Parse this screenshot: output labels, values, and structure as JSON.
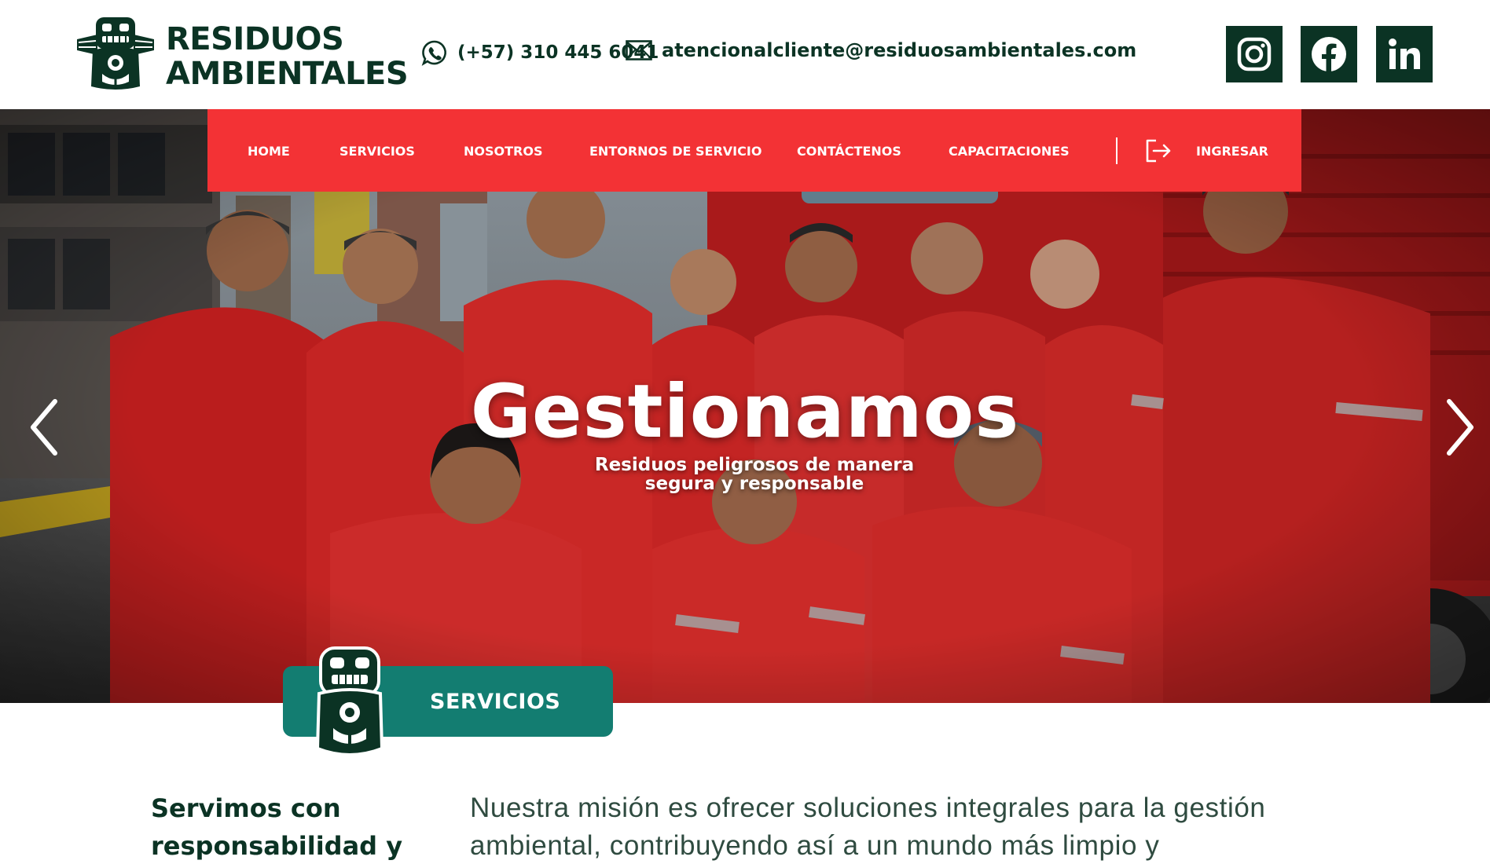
{
  "brand": {
    "line1": "RESIDUOS",
    "line2": "AMBIENTALES",
    "logo_icon": "mask-totem-logo",
    "color": "#0b3324"
  },
  "header": {
    "phone_icon": "whatsapp-icon",
    "phone": "(+57) 310 445 6041",
    "email_icon": "mail-icon",
    "email": "atencionalcliente@residuosambientales.com",
    "social": [
      {
        "icon": "instagram-icon"
      },
      {
        "icon": "facebook-icon"
      },
      {
        "icon": "linkedin-icon"
      }
    ]
  },
  "nav": {
    "color": "#f33235",
    "items": [
      "HOME",
      "SERVICIOS",
      "NOSOTROS",
      "ENTORNOS DE SERVICIO",
      "CONTÁCTENOS",
      "CAPACITACIONES"
    ],
    "login_icon": "login-icon",
    "login": "INGRESAR"
  },
  "hero": {
    "title": "Gestionamos",
    "subtitle": "Residuos peligrosos de manera segura y responsable",
    "prev_icon": "chevron-left-icon",
    "next_icon": "chevron-right-icon"
  },
  "services_badge": {
    "label": "SERVICIOS",
    "color": "#137d71"
  },
  "intro": {
    "heading": "Servimos con responsabilidad y",
    "text": "Nuestra misión es ofrecer soluciones integrales para la gestión ambiental, contribuyendo así a un mundo más limpio y sostenible."
  }
}
